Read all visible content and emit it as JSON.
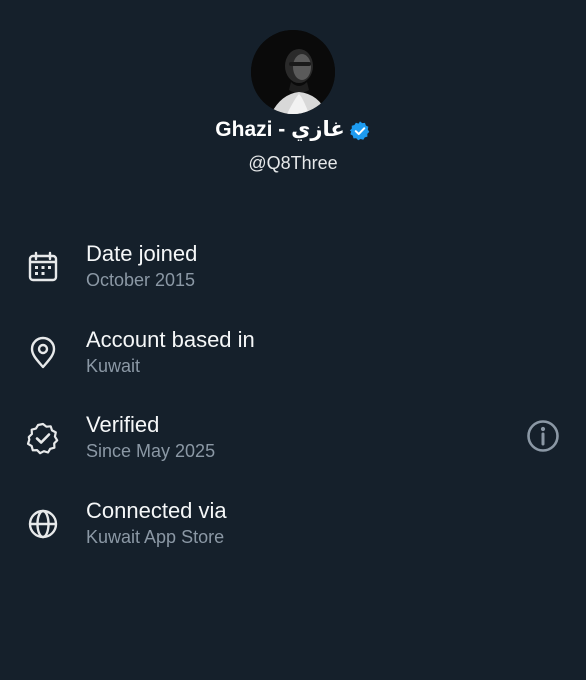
{
  "profile": {
    "display_name": "Ghazi - غازي",
    "handle": "@Q8Three",
    "verified": true,
    "badge_color": "#1d9bf0"
  },
  "details": [
    {
      "icon": "calendar-icon",
      "title": "Date joined",
      "value": "October 2015"
    },
    {
      "icon": "location-pin-icon",
      "title": "Account based in",
      "value": "Kuwait"
    },
    {
      "icon": "verified-check-icon",
      "title": "Verified",
      "value": "Since May 2025"
    },
    {
      "icon": "globe-icon",
      "title": "Connected via",
      "value": "Kuwait App Store"
    }
  ],
  "colors": {
    "background": "#15202b",
    "primary_text": "#ffffff",
    "secondary_text": "#8b98a5",
    "icon_stroke": "#e7e9ea",
    "info_icon": "#8b98a5"
  }
}
